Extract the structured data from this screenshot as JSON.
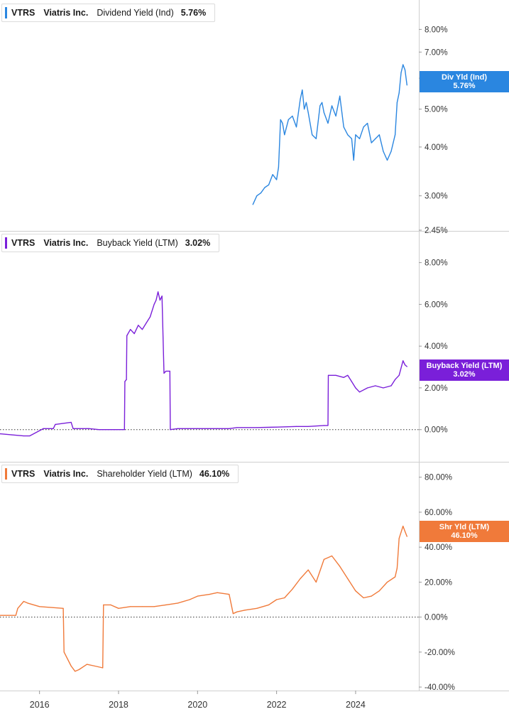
{
  "chart_data": [
    {
      "type": "line",
      "ticker": "VTRS",
      "company": "Viatris Inc.",
      "metric": "Dividend Yield (Ind)",
      "value": "5.76%",
      "tag_label": "Div Yld (Ind)",
      "tag_value": "5.76%",
      "color": "#2a86e0",
      "scale": "log",
      "ylim": [
        2.45,
        9.2
      ],
      "yticks": [
        "8.00%",
        "7.00%",
        "6.00%",
        "5.00%",
        "4.00%",
        "3.00%",
        "2.45%"
      ],
      "ytick_values": [
        8,
        7,
        6,
        5,
        4,
        3,
        2.45
      ],
      "zero_line": false,
      "x": [
        2021.4,
        2021.5,
        2021.6,
        2021.7,
        2021.8,
        2021.9,
        2022.0,
        2022.05,
        2022.1,
        2022.15,
        2022.2,
        2022.3,
        2022.4,
        2022.5,
        2022.6,
        2022.65,
        2022.7,
        2022.75,
        2022.8,
        2022.9,
        2023.0,
        2023.1,
        2023.15,
        2023.2,
        2023.3,
        2023.4,
        2023.5,
        2023.6,
        2023.7,
        2023.8,
        2023.9,
        2023.95,
        2024.0,
        2024.1,
        2024.2,
        2024.3,
        2024.4,
        2024.5,
        2024.6,
        2024.7,
        2024.8,
        2024.9,
        2025.0,
        2025.05,
        2025.1,
        2025.15,
        2025.2,
        2025.25,
        2025.3
      ],
      "values": [
        2.85,
        3.0,
        3.05,
        3.15,
        3.2,
        3.4,
        3.3,
        3.55,
        4.7,
        4.6,
        4.3,
        4.7,
        4.8,
        4.5,
        5.3,
        5.6,
        5.0,
        5.2,
        4.9,
        4.3,
        4.2,
        5.1,
        5.2,
        4.9,
        4.6,
        5.1,
        4.8,
        5.4,
        4.5,
        4.3,
        4.2,
        3.7,
        4.3,
        4.2,
        4.5,
        4.6,
        4.1,
        4.2,
        4.3,
        3.9,
        3.7,
        3.9,
        4.3,
        5.2,
        5.5,
        6.2,
        6.5,
        6.3,
        5.76
      ]
    },
    {
      "type": "line",
      "ticker": "VTRS",
      "company": "Viatris Inc.",
      "metric": "Buyback Yield (LTM)",
      "value": "3.02%",
      "tag_label": "Buyback Yield (LTM)",
      "tag_value": "3.02%",
      "color": "#7a1fd9",
      "scale": "linear",
      "ylim": [
        -1.2,
        8.6
      ],
      "yticks": [
        "8.00%",
        "6.00%",
        "4.00%",
        "2.00%",
        "0.00%"
      ],
      "ytick_values": [
        8,
        6,
        4,
        2,
        0
      ],
      "zero_line": true,
      "x": [
        2015.0,
        2015.3,
        2015.6,
        2015.7,
        2015.75,
        2016.1,
        2016.35,
        2016.4,
        2016.8,
        2016.85,
        2017.2,
        2017.25,
        2017.5,
        2017.9,
        2018.15,
        2018.16,
        2018.2,
        2018.21,
        2018.3,
        2018.4,
        2018.5,
        2018.6,
        2018.7,
        2018.8,
        2018.9,
        2018.95,
        2019.0,
        2019.05,
        2019.1,
        2019.15,
        2019.2,
        2019.25,
        2019.3,
        2019.31,
        2019.5,
        2020.0,
        2020.5,
        2020.8,
        2021.0,
        2021.5,
        2022.0,
        2022.5,
        2022.8,
        2023.2,
        2023.3,
        2023.31,
        2023.5,
        2023.7,
        2023.8,
        2023.9,
        2024.0,
        2024.1,
        2024.3,
        2024.5,
        2024.7,
        2024.9,
        2025.0,
        2025.1,
        2025.2,
        2025.25,
        2025.3
      ],
      "values": [
        -0.2,
        -0.25,
        -0.3,
        -0.3,
        -0.3,
        0.05,
        0.05,
        0.25,
        0.35,
        0.05,
        0.05,
        0.05,
        0.0,
        0.0,
        0.0,
        2.3,
        2.4,
        4.5,
        4.8,
        4.6,
        5.0,
        4.8,
        5.1,
        5.4,
        6.0,
        6.2,
        6.6,
        6.2,
        6.4,
        2.7,
        2.8,
        2.8,
        2.8,
        0.0,
        0.05,
        0.05,
        0.05,
        0.05,
        0.1,
        0.1,
        0.12,
        0.15,
        0.15,
        0.2,
        0.2,
        2.6,
        2.6,
        2.5,
        2.6,
        2.3,
        2.0,
        1.8,
        2.0,
        2.1,
        2.0,
        2.1,
        2.4,
        2.6,
        3.3,
        3.1,
        3.02
      ]
    },
    {
      "type": "line",
      "ticker": "VTRS",
      "company": "Viatris Inc.",
      "metric": "Shareholder Yield (LTM)",
      "value": "46.10%",
      "tag_label": "Shr Yld (LTM)",
      "tag_value": "46.10%",
      "color": "#f07a3a",
      "scale": "linear",
      "ylim": [
        -42,
        88
      ],
      "yticks": [
        "80.00%",
        "60.00%",
        "40.00%",
        "20.00%",
        "0.00%",
        "-20.00%",
        "-40.00%"
      ],
      "ytick_values": [
        80,
        60,
        40,
        20,
        0,
        -20,
        -40
      ],
      "zero_line": true,
      "x": [
        2015.0,
        2015.4,
        2015.45,
        2015.6,
        2015.7,
        2016.0,
        2016.6,
        2016.62,
        2016.8,
        2016.9,
        2017.0,
        2017.2,
        2017.4,
        2017.6,
        2017.62,
        2017.8,
        2018.0,
        2018.3,
        2018.6,
        2018.9,
        2019.2,
        2019.5,
        2019.8,
        2020.0,
        2020.3,
        2020.5,
        2020.8,
        2020.9,
        2021.0,
        2021.2,
        2021.5,
        2021.8,
        2022.0,
        2022.2,
        2022.4,
        2022.6,
        2022.8,
        2023.0,
        2023.2,
        2023.4,
        2023.6,
        2023.8,
        2024.0,
        2024.2,
        2024.4,
        2024.6,
        2024.8,
        2025.0,
        2025.05,
        2025.1,
        2025.2,
        2025.25,
        2025.3
      ],
      "values": [
        1,
        1,
        5,
        9,
        8,
        6,
        5,
        -20,
        -28,
        -31,
        -30,
        -27,
        -28,
        -29,
        7,
        7,
        5,
        6,
        6,
        6,
        7,
        8,
        10,
        12,
        13,
        14,
        13,
        2,
        3,
        4,
        5,
        7,
        10,
        11,
        16,
        22,
        27,
        20,
        33,
        35,
        29,
        22,
        15,
        11,
        12,
        15,
        20,
        23,
        28,
        45,
        52,
        49,
        46.1
      ]
    }
  ],
  "x_axis": {
    "ticks": [
      "2016",
      "2018",
      "2020",
      "2022",
      "2024"
    ],
    "tick_values": [
      2016,
      2018,
      2020,
      2022,
      2024
    ],
    "range": [
      2015.0,
      2025.6
    ]
  }
}
